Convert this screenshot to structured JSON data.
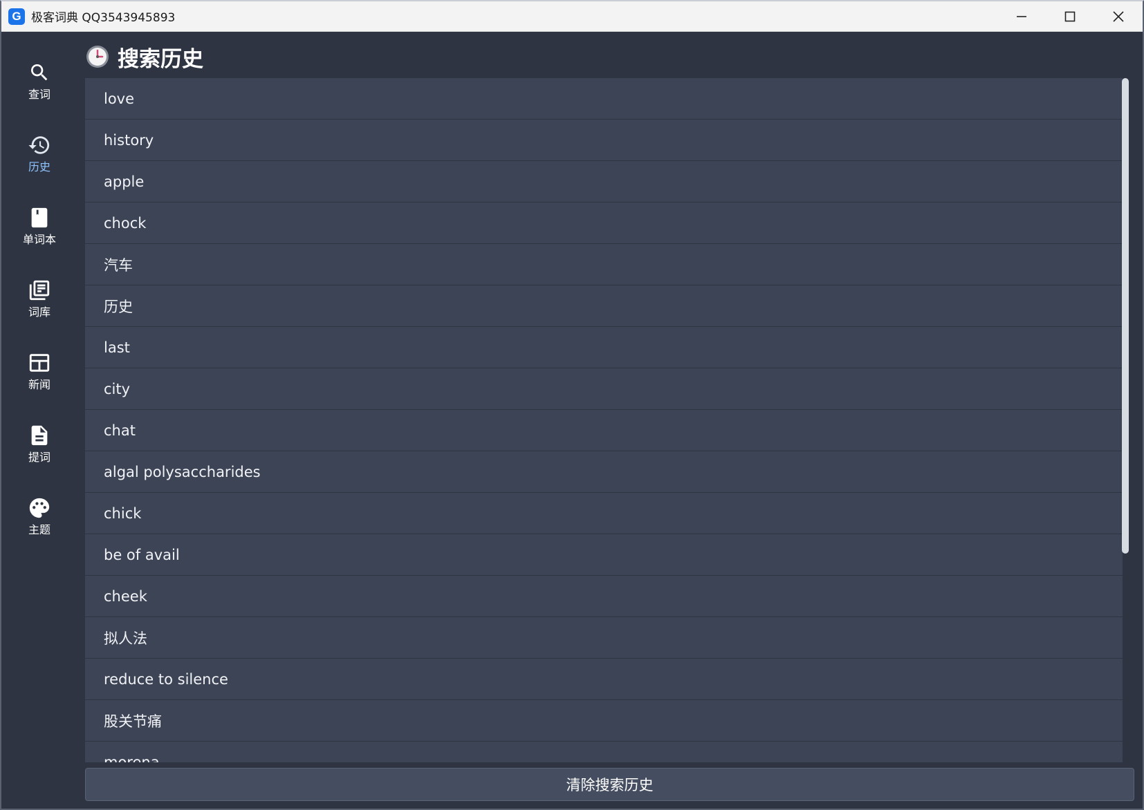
{
  "window": {
    "logo_letter": "G",
    "title": "极客词典 QQ3543945893"
  },
  "sidebar": {
    "items": [
      {
        "icon": "search-icon",
        "label": "查词"
      },
      {
        "icon": "history-icon",
        "label": "历史",
        "active": true
      },
      {
        "icon": "bookmark-icon",
        "label": "单词本"
      },
      {
        "icon": "library-icon",
        "label": "词库"
      },
      {
        "icon": "news-icon",
        "label": "新闻"
      },
      {
        "icon": "document-icon",
        "label": "提词"
      },
      {
        "icon": "palette-icon",
        "label": "主题"
      }
    ]
  },
  "header": {
    "icon": "clock-icon",
    "title": "搜索历史"
  },
  "history": {
    "items": [
      "love",
      "history",
      "apple",
      "chock",
      "汽车",
      "历史",
      "last",
      "city",
      "chat",
      "algal polysaccharides",
      "chick",
      "be of avail",
      "cheek",
      "拟人法",
      "reduce to silence",
      "股关节痛",
      "morena"
    ]
  },
  "footer": {
    "clear_label": "清除搜索历史"
  },
  "colors": {
    "background": "#2e3441",
    "list_item": "#3d4455",
    "active_nav": "#8fc3ff",
    "logo": "#1a73e8"
  }
}
